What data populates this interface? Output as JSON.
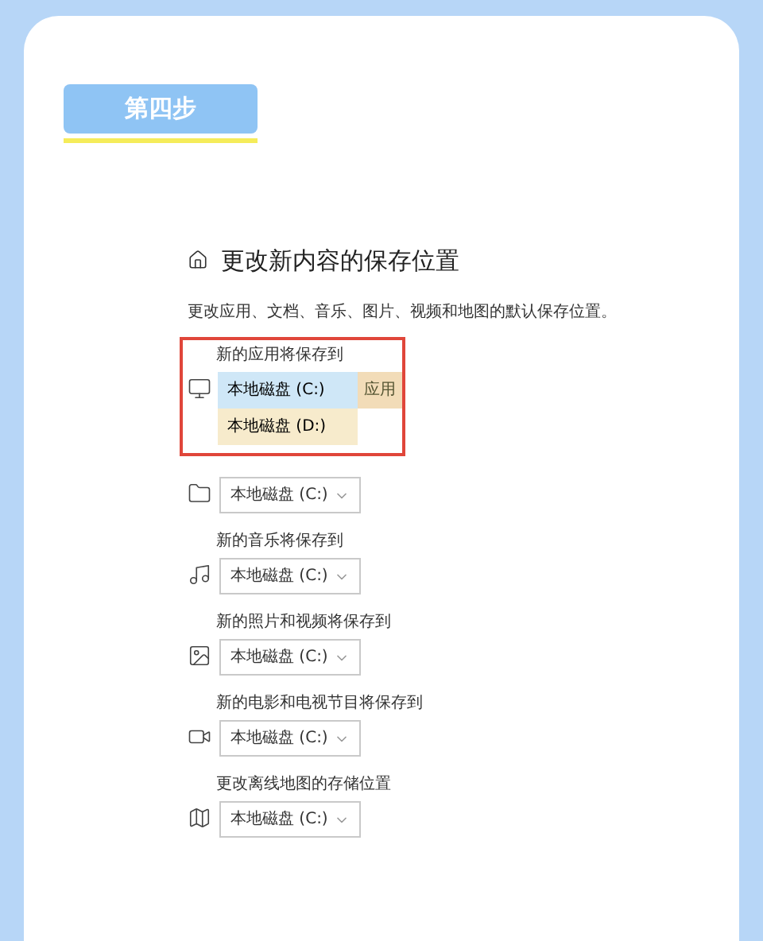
{
  "badge": "第四步",
  "title": "更改新内容的保存位置",
  "description": "更改应用、文档、音乐、图片、视频和地图的默认保存位置。",
  "sections": [
    {
      "label": "新的应用将保存到",
      "highlighted": true,
      "dropdown": {
        "expanded": true,
        "tag": "应用",
        "options": [
          {
            "label": "本地磁盘 (C:)",
            "selected": true
          },
          {
            "label": "本地磁盘 (D:)",
            "selected": false
          }
        ]
      }
    },
    {
      "dropdown": {
        "value": "本地磁盘 (C:)",
        "expanded": false
      }
    },
    {
      "label": "新的音乐将保存到",
      "dropdown": {
        "value": "本地磁盘 (C:)",
        "expanded": false
      }
    },
    {
      "label": "新的照片和视频将保存到",
      "dropdown": {
        "value": "本地磁盘 (C:)",
        "expanded": false
      }
    },
    {
      "label": "新的电影和电视节目将保存到",
      "dropdown": {
        "value": "本地磁盘 (C:)",
        "expanded": false
      }
    },
    {
      "label": "更改离线地图的存储位置",
      "dropdown": {
        "value": "本地磁盘 (C:)",
        "expanded": false
      }
    }
  ]
}
